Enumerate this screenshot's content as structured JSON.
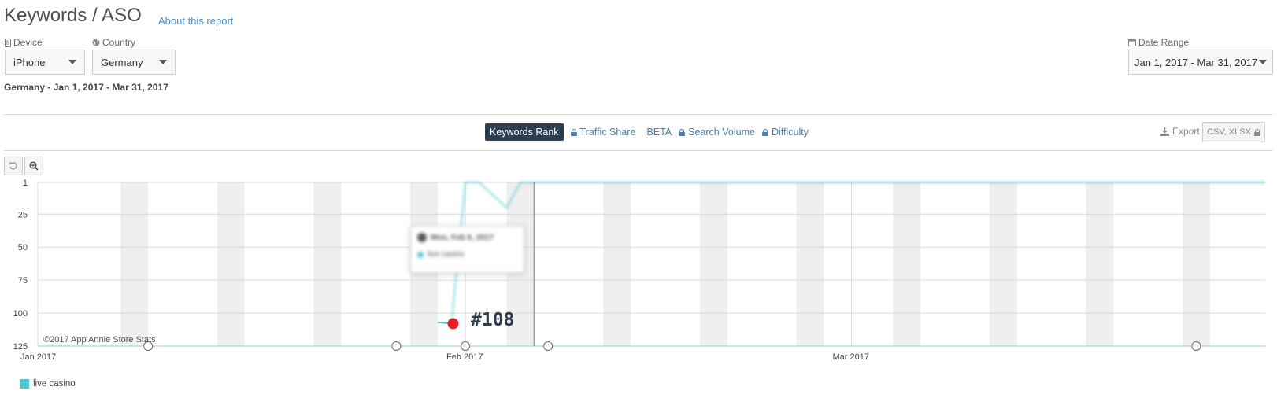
{
  "header": {
    "title": "Keywords / ASO",
    "about_link": "About this report"
  },
  "filters": {
    "device_label": "Device",
    "device_value": "iPhone",
    "country_label": "Country",
    "country_value": "Germany",
    "date_range_label": "Date Range",
    "date_range_value": "Jan 1, 2017 - Mar 31, 2017"
  },
  "subtitle": "Germany - Jan 1, 2017 - Mar 31, 2017",
  "tabs": {
    "keywords_rank": "Keywords Rank",
    "traffic_share": "Traffic Share",
    "beta": "BETA",
    "search_volume": "Search Volume",
    "difficulty": "Difficulty"
  },
  "export": {
    "label": "Export",
    "formats": "CSV, XLSX"
  },
  "tooltip": {
    "date": "Mon, Feb 6, 2017",
    "series": "live casino"
  },
  "chart_data": {
    "type": "line",
    "y_reversed": true,
    "ylim": [
      1,
      125
    ],
    "y_ticks": [
      "1",
      "25",
      "50",
      "75",
      "100",
      "125"
    ],
    "x_tick_labels": [
      "Jan 2017",
      "Feb 2017",
      "Mar 2017"
    ],
    "series": [
      {
        "name": "live casino",
        "color": "#4fc6d0",
        "points": [
          {
            "x": "2017-01-30",
            "y": 107
          },
          {
            "x": "2017-01-31",
            "y": 108
          },
          {
            "x": "2017-02-01",
            "y": 1
          },
          {
            "x": "2017-02-02",
            "y": 1
          },
          {
            "x": "2017-02-04",
            "y": 20
          },
          {
            "x": "2017-02-05",
            "y": 1
          },
          {
            "x": "2017-03-31",
            "y": 1
          }
        ]
      }
    ],
    "grid": true,
    "legend_position": "bottom-left"
  },
  "annotation": {
    "rank_callout": "#108",
    "copyright": "©2017 App Annie Store Stats",
    "highlight_color": "#ee1c25"
  }
}
